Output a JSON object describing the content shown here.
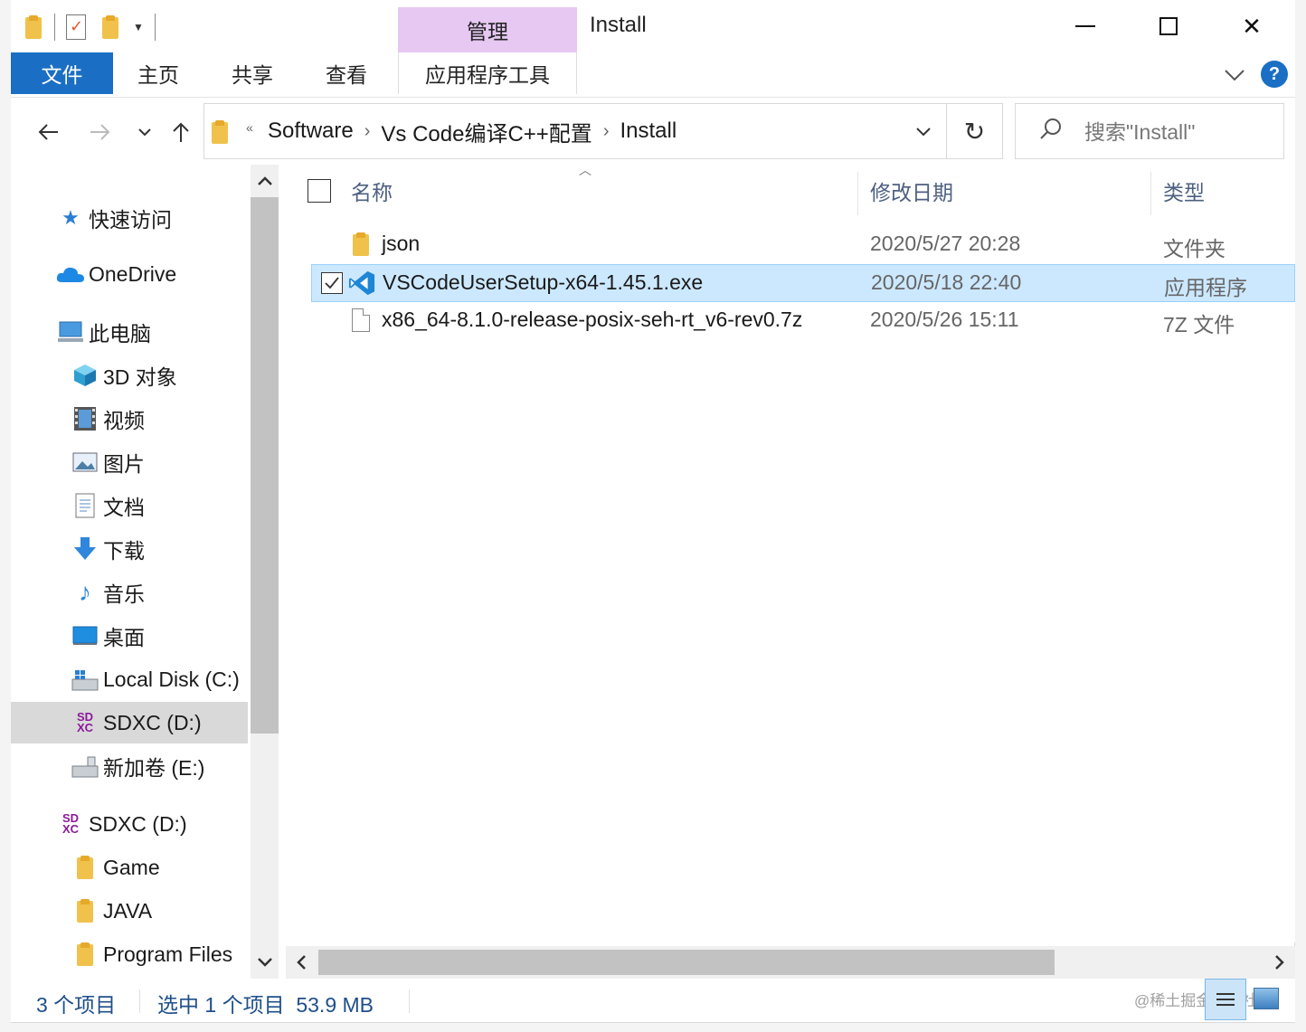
{
  "titlebar": {
    "manage_tab": "管理",
    "window_title": "Install"
  },
  "ribbon": {
    "tabs": [
      {
        "label": "文件"
      },
      {
        "label": "主页"
      },
      {
        "label": "共享"
      },
      {
        "label": "查看"
      },
      {
        "label": "应用程序工具"
      }
    ],
    "help_label": "?"
  },
  "address": {
    "prefix": "«",
    "crumbs": [
      "Software",
      "Vs Code编译C++配置",
      "Install"
    ]
  },
  "search": {
    "placeholder": "搜索\"Install\""
  },
  "navpane": {
    "quick_access": "快速访问",
    "onedrive": "OneDrive",
    "this_pc": "此电脑",
    "items": [
      {
        "label": "3D 对象",
        "icon": "cube-icon"
      },
      {
        "label": "视频",
        "icon": "film-icon"
      },
      {
        "label": "图片",
        "icon": "picture-icon"
      },
      {
        "label": "文档",
        "icon": "document-icon"
      },
      {
        "label": "下载",
        "icon": "download-arrow-icon"
      },
      {
        "label": "音乐",
        "icon": "music-note-icon"
      },
      {
        "label": "桌面",
        "icon": "desktop-icon"
      },
      {
        "label": "Local Disk (C:)",
        "icon": "drive-c-icon"
      },
      {
        "label": "SDXC (D:)",
        "icon": "sdxc-icon"
      },
      {
        "label": "新加卷 (E:)",
        "icon": "drive-icon"
      }
    ],
    "drive_d": "SDXC (D:)",
    "drive_d_folders": [
      "Game",
      "JAVA",
      "Program Files"
    ]
  },
  "columns": {
    "name": "名称",
    "date": "修改日期",
    "type": "类型"
  },
  "files": [
    {
      "name": "json",
      "date": "2020/5/27 20:28",
      "type": "文件夹",
      "icon": "folder-icon",
      "selected": false
    },
    {
      "name": "VSCodeUserSetup-x64-1.45.1.exe",
      "date": "2020/5/18 22:40",
      "type": "应用程序",
      "icon": "vscode-icon",
      "selected": true
    },
    {
      "name": "x86_64-8.1.0-release-posix-seh-rt_v6-rev0.7z",
      "date": "2020/5/26 15:11",
      "type": "7Z 文件",
      "icon": "file-icon",
      "selected": false
    }
  ],
  "status": {
    "item_count": "3 个项目",
    "selection": "选中 1 个项目  53.9 MB",
    "watermark": "@稀土掘金技术社区"
  },
  "colors": {
    "accent": "#1a6fc4",
    "manage_tab": "#e6c8f2",
    "selection_bg": "#cce8ff",
    "selection_border": "#99d1ff"
  }
}
